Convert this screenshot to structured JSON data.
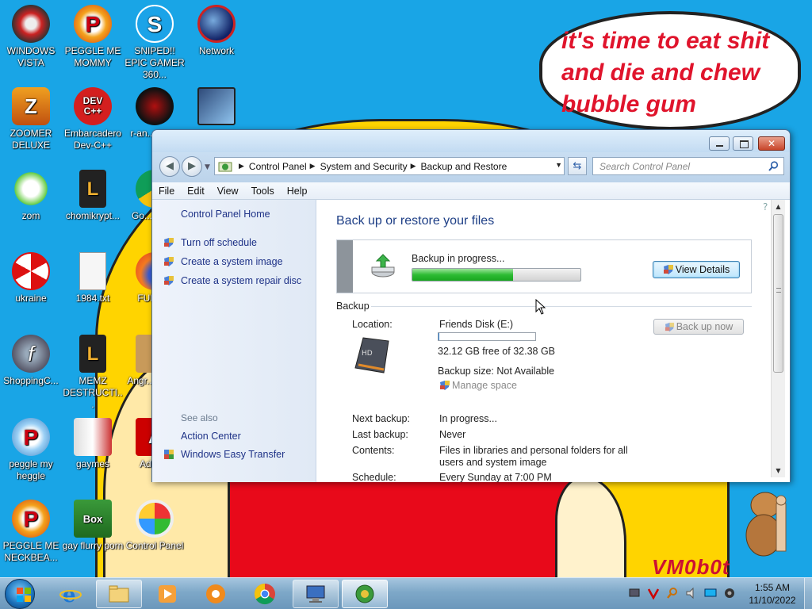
{
  "wallpaper": {
    "speech_bubble": "it's time to eat shit and die and chew bubble gum",
    "signature": "VM0b0t"
  },
  "desktop_icons": [
    {
      "label": "WINDOWS VISTA",
      "icon": "windows-vista-orb-icon"
    },
    {
      "label": "PEGGLE ME MOMMY",
      "icon": "peggle-icon"
    },
    {
      "label": "SNIPED!! EPIC GAMER 360...",
      "icon": "skype-icon"
    },
    {
      "label": "Network",
      "icon": "network-globe-icon"
    },
    {
      "label": "ZOOMER DELUXE",
      "icon": "zoomer-icon"
    },
    {
      "label": "Embarcadero Dev-C++",
      "icon": "devcpp-icon"
    },
    {
      "label": "r-an... par...",
      "icon": "red-dark-icon"
    },
    {
      "label": "",
      "icon": "monitor-icon"
    },
    {
      "label": "zom",
      "icon": "zom-flower-icon"
    },
    {
      "label": "chomikrypt...",
      "icon": "chomikrypt-icon"
    },
    {
      "label": "Go... Chr...",
      "icon": "chrome-icon"
    },
    {
      "label": "ukraine",
      "icon": "radiation-icon"
    },
    {
      "label": "1984.txt",
      "icon": "text-file-icon"
    },
    {
      "label": "FURR...",
      "icon": "firefox-icon"
    },
    {
      "label": "ShoppingC...",
      "icon": "flash-icon"
    },
    {
      "label": "MEMZ DESTRUCTI...",
      "icon": "memz-icon"
    },
    {
      "label": "Angr... Sea...",
      "icon": "angry-birds-icon"
    },
    {
      "label": "peggle my heggle",
      "icon": "peggle-icon"
    },
    {
      "label": "gaymes",
      "icon": "games-folder-icon"
    },
    {
      "label": "Adob...",
      "icon": "adobe-icon"
    },
    {
      "label": "PEGGLE ME NECKBEA...",
      "icon": "peggle-icon"
    },
    {
      "label": "gay flurry porn",
      "icon": "box-beaver-icon"
    },
    {
      "label": "Control Panel",
      "icon": "control-panel-icon"
    }
  ],
  "window": {
    "address": {
      "crumbs": [
        "Control Panel",
        "System and Security",
        "Backup and Restore"
      ],
      "search_placeholder": "Search Control Panel"
    },
    "menu": [
      "File",
      "Edit",
      "View",
      "Tools",
      "Help"
    ],
    "left_pane": {
      "home": "Control Panel Home",
      "tasks": [
        "Turn off schedule",
        "Create a system image",
        "Create a system repair disc"
      ],
      "see_also_label": "See also",
      "see_also": [
        "Action Center",
        "Windows Easy Transfer"
      ]
    },
    "main": {
      "title": "Back up or restore your files",
      "progress": {
        "status": "Backup in progress...",
        "fraction": 0.6,
        "button": "View Details"
      },
      "section_label": "Backup",
      "location_label": "Location:",
      "location_value": "Friends Disk (E:)",
      "disk_used_fraction": 0.01,
      "free_space": "32.12 GB free of 32.38 GB",
      "backup_size": "Backup size: Not Available",
      "manage_space": "Manage space",
      "backup_now_button": "Back up now",
      "next_backup_label": "Next backup:",
      "next_backup_value": "In progress...",
      "last_backup_label": "Last backup:",
      "last_backup_value": "Never",
      "contents_label": "Contents:",
      "contents_value": "Files in libraries and personal folders for all users and system image",
      "schedule_label": "Schedule:",
      "schedule_value": "Every Sunday at 7:00 PM"
    }
  },
  "taskbar": {
    "pinned": [
      "internet-explorer-icon",
      "explorer-folder-icon",
      "media-player-icon",
      "uc-browser-icon",
      "chrome-icon",
      "remote-desktop-icon",
      "backup-restore-icon"
    ],
    "clock_time": "1:55 AM",
    "clock_date": "11/10/2022"
  }
}
